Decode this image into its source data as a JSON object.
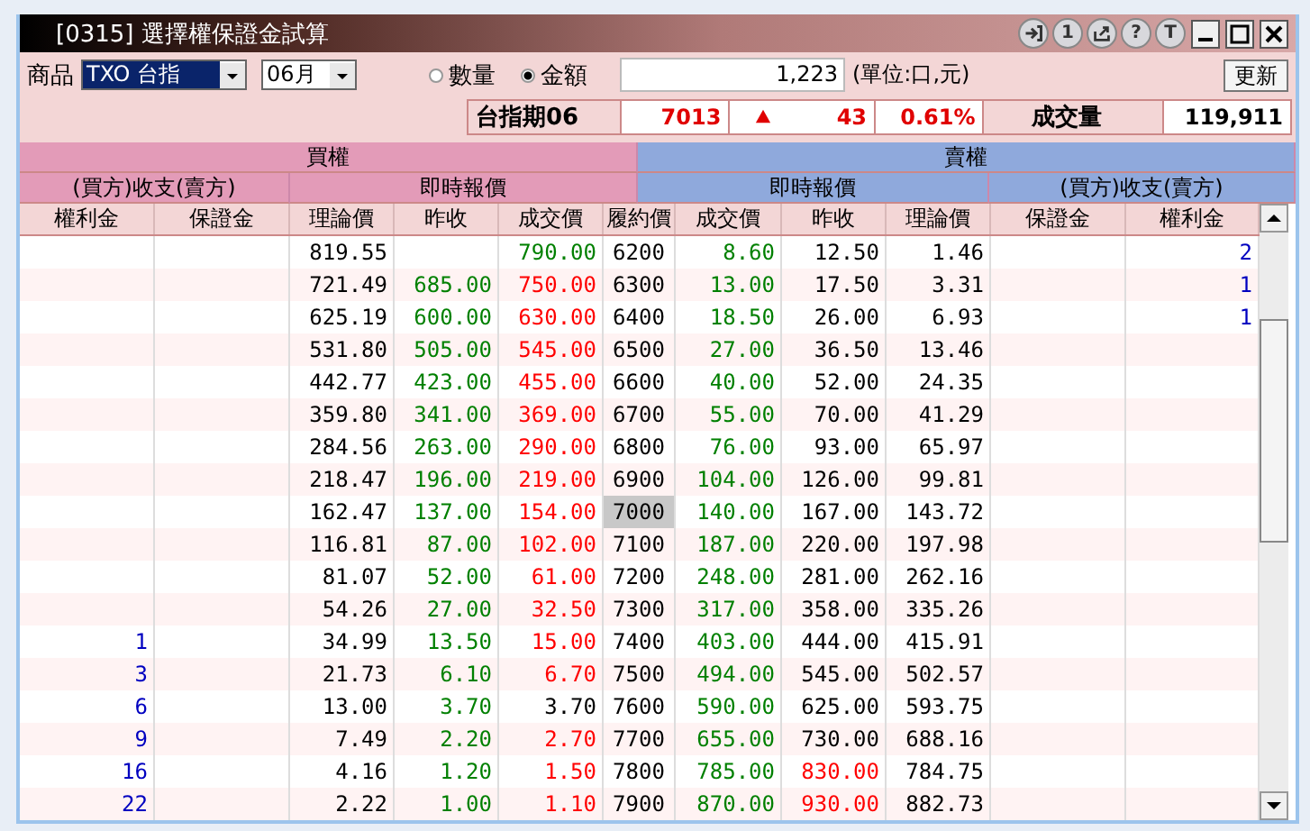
{
  "window": {
    "title": "[0315] 選擇權保證金試算",
    "title_buttons": [
      {
        "kind": "enter"
      },
      {
        "kind": "glyph",
        "text": "1"
      },
      {
        "kind": "export"
      },
      {
        "kind": "glyph",
        "text": "?"
      },
      {
        "kind": "glyph",
        "text": "T"
      }
    ]
  },
  "toolbar": {
    "product_label": "商品",
    "product": "TXO 台指",
    "month": "06月",
    "modes": [
      {
        "label": "數量",
        "selected": false
      },
      {
        "label": "金額",
        "selected": true
      }
    ],
    "amount": "1,223",
    "unit": "(單位:口,元)",
    "refresh_button": "更新"
  },
  "quote": {
    "name": "台指期06",
    "price": "7013",
    "rising": true,
    "change": "43",
    "percent": "0.61%",
    "volume_label": "成交量",
    "volume": "119,911"
  },
  "table": {
    "groups": [
      {
        "label": "買權",
        "kind": "call"
      },
      {
        "label": "賣權",
        "kind": "put"
      }
    ],
    "subgroups": [
      {
        "label": "(買方)收支(賣方)",
        "kind": "call"
      },
      {
        "label": "即時報價",
        "kind": "call"
      },
      {
        "label": "即時報價",
        "kind": "put"
      },
      {
        "label": "(買方)收支(賣方)",
        "kind": "put"
      }
    ],
    "columns": [
      "權利金",
      "保證金",
      "理論價",
      "昨收",
      "成交價",
      "履約價",
      "成交價",
      "昨收",
      "理論價",
      "保證金",
      "權利金"
    ],
    "rows": [
      {
        "selected": false,
        "call_theo": "819.55",
        "call_last": {
          "text": "790.00",
          "color": "#008000"
        },
        "strike": "6200",
        "put_last": {
          "text": "8.60",
          "color": "#008000"
        },
        "put_prev": "12.50",
        "put_theo": "1.46",
        "put_premium": {
          "text": "2",
          "color": "#0000c0"
        }
      },
      {
        "selected": false,
        "call_theo": "721.49",
        "call_prev": {
          "text": "685.00",
          "color": "#008000"
        },
        "call_last": {
          "text": "750.00",
          "color": "#ff0000"
        },
        "strike": "6300",
        "put_last": {
          "text": "13.00",
          "color": "#008000"
        },
        "put_prev": "17.50",
        "put_theo": "3.31",
        "put_premium": {
          "text": "1",
          "color": "#0000c0"
        }
      },
      {
        "selected": false,
        "call_theo": "625.19",
        "call_prev": {
          "text": "600.00",
          "color": "#008000"
        },
        "call_last": {
          "text": "630.00",
          "color": "#ff0000"
        },
        "strike": "6400",
        "put_last": {
          "text": "18.50",
          "color": "#008000"
        },
        "put_prev": "26.00",
        "put_theo": "6.93",
        "put_premium": {
          "text": "1",
          "color": "#0000c0"
        }
      },
      {
        "selected": false,
        "call_theo": "531.80",
        "call_prev": {
          "text": "505.00",
          "color": "#008000"
        },
        "call_last": {
          "text": "545.00",
          "color": "#ff0000"
        },
        "strike": "6500",
        "put_last": {
          "text": "27.00",
          "color": "#008000"
        },
        "put_prev": "36.50",
        "put_theo": "13.46"
      },
      {
        "selected": false,
        "call_theo": "442.77",
        "call_prev": {
          "text": "423.00",
          "color": "#008000"
        },
        "call_last": {
          "text": "455.00",
          "color": "#ff0000"
        },
        "strike": "6600",
        "put_last": {
          "text": "40.00",
          "color": "#008000"
        },
        "put_prev": "52.00",
        "put_theo": "24.35"
      },
      {
        "selected": false,
        "call_theo": "359.80",
        "call_prev": {
          "text": "341.00",
          "color": "#008000"
        },
        "call_last": {
          "text": "369.00",
          "color": "#ff0000"
        },
        "strike": "6700",
        "put_last": {
          "text": "55.00",
          "color": "#008000"
        },
        "put_prev": "70.00",
        "put_theo": "41.29"
      },
      {
        "selected": false,
        "call_theo": "284.56",
        "call_prev": {
          "text": "263.00",
          "color": "#008000"
        },
        "call_last": {
          "text": "290.00",
          "color": "#ff0000"
        },
        "strike": "6800",
        "put_last": {
          "text": "76.00",
          "color": "#008000"
        },
        "put_prev": "93.00",
        "put_theo": "65.97"
      },
      {
        "selected": false,
        "call_theo": "218.47",
        "call_prev": {
          "text": "196.00",
          "color": "#008000"
        },
        "call_last": {
          "text": "219.00",
          "color": "#ff0000"
        },
        "strike": "6900",
        "put_last": {
          "text": "104.00",
          "color": "#008000"
        },
        "put_prev": "126.00",
        "put_theo": "99.81"
      },
      {
        "selected": true,
        "call_theo": "162.47",
        "call_prev": {
          "text": "137.00",
          "color": "#008000"
        },
        "call_last": {
          "text": "154.00",
          "color": "#ff0000"
        },
        "strike": "7000",
        "put_last": {
          "text": "140.00",
          "color": "#008000"
        },
        "put_prev": "167.00",
        "put_theo": "143.72"
      },
      {
        "selected": false,
        "call_theo": "116.81",
        "call_prev": {
          "text": "87.00",
          "color": "#008000"
        },
        "call_last": {
          "text": "102.00",
          "color": "#ff0000"
        },
        "strike": "7100",
        "put_last": {
          "text": "187.00",
          "color": "#008000"
        },
        "put_prev": "220.00",
        "put_theo": "197.98"
      },
      {
        "selected": false,
        "call_theo": "81.07",
        "call_prev": {
          "text": "52.00",
          "color": "#008000"
        },
        "call_last": {
          "text": "61.00",
          "color": "#ff0000"
        },
        "strike": "7200",
        "put_last": {
          "text": "248.00",
          "color": "#008000"
        },
        "put_prev": "281.00",
        "put_theo": "262.16"
      },
      {
        "selected": false,
        "call_theo": "54.26",
        "call_prev": {
          "text": "27.00",
          "color": "#008000"
        },
        "call_last": {
          "text": "32.50",
          "color": "#ff0000"
        },
        "strike": "7300",
        "put_last": {
          "text": "317.00",
          "color": "#008000"
        },
        "put_prev": "358.00",
        "put_theo": "335.26"
      },
      {
        "selected": false,
        "call_premium": {
          "text": "1",
          "color": "#0000c0"
        },
        "call_theo": "34.99",
        "call_prev": {
          "text": "13.50",
          "color": "#008000"
        },
        "call_last": {
          "text": "15.00",
          "color": "#ff0000"
        },
        "strike": "7400",
        "put_last": {
          "text": "403.00",
          "color": "#008000"
        },
        "put_prev": "444.00",
        "put_theo": "415.91"
      },
      {
        "selected": false,
        "call_premium": {
          "text": "3",
          "color": "#0000c0"
        },
        "call_theo": "21.73",
        "call_prev": {
          "text": "6.10",
          "color": "#008000"
        },
        "call_last": {
          "text": "6.70",
          "color": "#ff0000"
        },
        "strike": "7500",
        "put_last": {
          "text": "494.00",
          "color": "#008000"
        },
        "put_prev": "545.00",
        "put_theo": "502.57"
      },
      {
        "selected": false,
        "call_premium": {
          "text": "6",
          "color": "#0000c0"
        },
        "call_theo": "13.00",
        "call_prev": {
          "text": "3.70",
          "color": "#008000"
        },
        "call_last": "3.70",
        "strike": "7600",
        "put_last": {
          "text": "590.00",
          "color": "#008000"
        },
        "put_prev": "625.00",
        "put_theo": "593.75"
      },
      {
        "selected": false,
        "call_premium": {
          "text": "9",
          "color": "#0000c0"
        },
        "call_theo": "7.49",
        "call_prev": {
          "text": "2.20",
          "color": "#008000"
        },
        "call_last": {
          "text": "2.70",
          "color": "#ff0000"
        },
        "strike": "7700",
        "put_last": {
          "text": "655.00",
          "color": "#008000"
        },
        "put_prev": "730.00",
        "put_theo": "688.16"
      },
      {
        "selected": false,
        "call_premium": {
          "text": "16",
          "color": "#0000c0"
        },
        "call_theo": "4.16",
        "call_prev": {
          "text": "1.20",
          "color": "#008000"
        },
        "call_last": {
          "text": "1.50",
          "color": "#ff0000"
        },
        "strike": "7800",
        "put_last": {
          "text": "785.00",
          "color": "#008000"
        },
        "put_prev": {
          "text": "830.00",
          "color": "#ff0000"
        },
        "put_theo": "784.75"
      },
      {
        "selected": false,
        "call_premium": {
          "text": "22",
          "color": "#0000c0"
        },
        "call_theo": "2.22",
        "call_prev": {
          "text": "1.00",
          "color": "#008000"
        },
        "call_last": {
          "text": "1.10",
          "color": "#ff0000"
        },
        "strike": "7900",
        "put_last": {
          "text": "870.00",
          "color": "#008000"
        },
        "put_prev": {
          "text": "930.00",
          "color": "#ff0000"
        },
        "put_theo": "882.73"
      }
    ]
  }
}
